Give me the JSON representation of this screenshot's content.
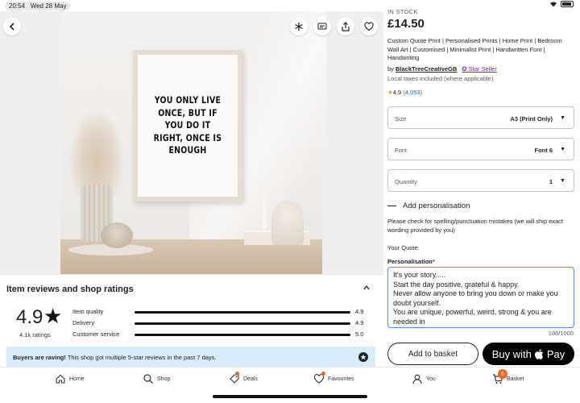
{
  "status_bar": {
    "time": "20:54",
    "date": "Wed 28 May"
  },
  "photo": {
    "poster_text": "YOU ONLY LIVE ONCE, BUT IF YOU DO IT RIGHT, ONCE IS ENOUGH"
  },
  "reviews": {
    "title": "Item reviews and shop ratings",
    "overall_rating": "4.9",
    "ratings_count": "4.1k ratings",
    "rows": [
      {
        "label": "Item quality",
        "value": "4.9"
      },
      {
        "label": "Delivery",
        "value": "4.9"
      },
      {
        "label": "Customer service",
        "value": "5.0"
      }
    ],
    "banner_bold": "Buyers are raving!",
    "banner_text": " This shop got multiple 5-star reviews in the past 7 days."
  },
  "nav": {
    "home": "Home",
    "shop": "Shop",
    "deals": "Deals",
    "favourites": "Favourites",
    "you": "You",
    "basket": "Basket",
    "basket_count": "6"
  },
  "listing": {
    "stock": "IN STOCK",
    "price": "£14.50",
    "description": "Custom Quote Print | Personalised Prints | Home Print | Bedroom Wall Art | Customised | Minimalist Print | Handwritten Font | Handwriting",
    "by": "by ",
    "shop_name": "BlackTreeCreativeGB",
    "star_seller": "Star Seller",
    "taxes": "Local taxes included (where applicable)",
    "rating": "4.9",
    "rating_count": "(4,053)",
    "size_label": "Size",
    "size_value": "A3 (Print Only)",
    "font_label": "Font",
    "font_value": "Font 6",
    "quantity_label": "Quantity",
    "quantity_value": "1",
    "add_personalisation": "Add personalisation",
    "hint": "Please check for spelling/punctuation mistakes (we will ship exact wording provided by you)",
    "your_quote": "Your Quote:",
    "personalisation_label": "Personalisation",
    "personalisation_value": "It's your story.....\nStart the day positive, grateful & happy.\nNever allow anyone to bring you down or make you doubt yourself.\nYou are unique, powerful, weird, strong & you are needed in",
    "char_count": "186/1000",
    "add_to_basket": "Add to basket",
    "buy_with": "Buy with",
    "pay": "Pay"
  }
}
